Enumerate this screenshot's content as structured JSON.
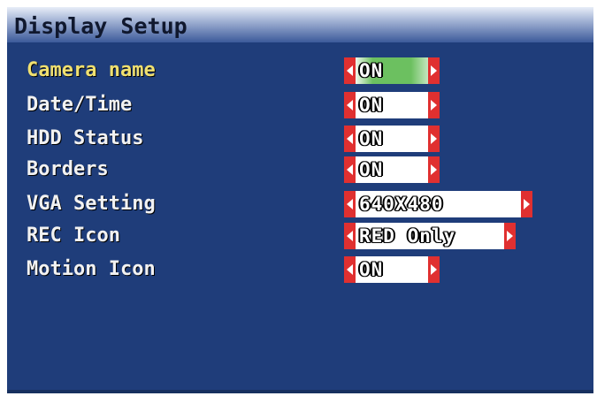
{
  "window": {
    "title": "Display Setup"
  },
  "menu": {
    "items": [
      {
        "label": "Camera name",
        "value": "ON"
      },
      {
        "label": "Date/Time",
        "value": "ON"
      },
      {
        "label": "HDD Status",
        "value": "ON"
      },
      {
        "label": "Borders",
        "value": "ON"
      },
      {
        "label": "VGA Setting",
        "value": "640X480"
      },
      {
        "label": "REC Icon",
        "value": "RED Only"
      },
      {
        "label": "Motion Icon",
        "value": "ON"
      }
    ]
  },
  "colors": {
    "background": "#1f3d7a",
    "arrow": "#e03030",
    "selected_label": "#f0e070",
    "selected_value_bg": "#6cc060"
  },
  "icons": {
    "decrement": "left-arrow-icon",
    "increment": "right-arrow-icon"
  }
}
